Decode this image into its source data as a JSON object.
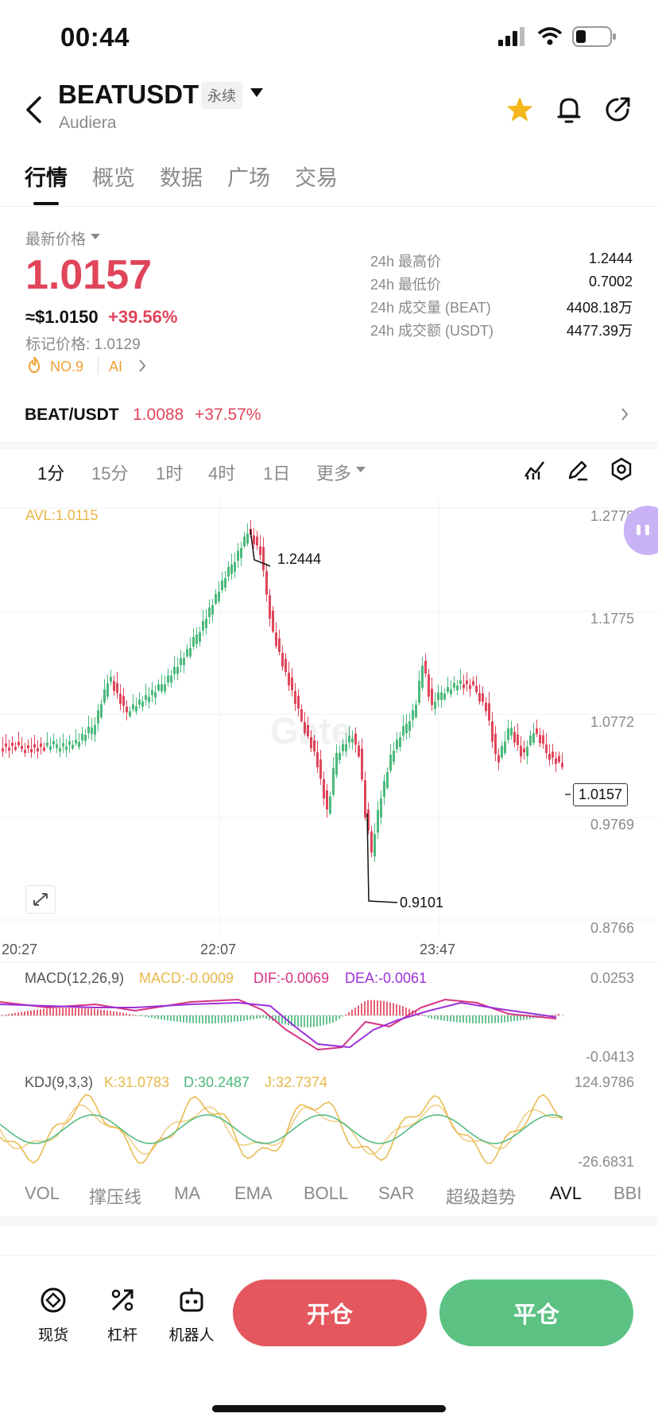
{
  "status": {
    "time": "00:44"
  },
  "header": {
    "symbol": "BEATUSDT",
    "badge": "永续",
    "subtitle": "Audiera"
  },
  "tabs": [
    "行情",
    "概览",
    "数据",
    "广场",
    "交易"
  ],
  "price": {
    "latest_label": "最新价格",
    "last": "1.0157",
    "usd": "≈$1.0150",
    "change": "+39.56%",
    "mark": "标记价格: 1.0129",
    "rank": "NO.9",
    "ai": "AI"
  },
  "stats": [
    {
      "label": "24h 最高价",
      "value": "1.2444"
    },
    {
      "label": "24h 最低价",
      "value": "0.7002"
    },
    {
      "label": "24h 成交量 (BEAT)",
      "value": "4408.18万"
    },
    {
      "label": "24h 成交额 (USDT)",
      "value": "4477.39万"
    }
  ],
  "spot": {
    "pair": "BEAT/USDT",
    "price": "1.0088",
    "change": "+37.57%"
  },
  "timeframes": [
    "1分",
    "15分",
    "1时",
    "4时",
    "1日",
    "更多"
  ],
  "chart": {
    "avl": "AVL:1.0115",
    "yticks": [
      "1.2778",
      "1.1775",
      "1.0772",
      "0.9769",
      "0.8766"
    ],
    "xticks": [
      "20:27",
      "22:07",
      "23:47"
    ],
    "high_label": "1.2444",
    "low_label": "0.9101",
    "current": "1.0157",
    "watermark": "Gate"
  },
  "macd": {
    "title": "MACD(12,26,9)",
    "macd": "MACD:-0.0009",
    "dif": "DIF:-0.0069",
    "dea": "DEA:-0.0061",
    "top": "0.0253",
    "bottom": "-0.0413"
  },
  "kdj": {
    "title": "KDJ(9,3,3)",
    "k": "K:31.0783",
    "d": "D:30.2487",
    "j": "J:32.7374",
    "top": "124.9786",
    "bottom": "-26.6831"
  },
  "indicators": [
    "VOL",
    "撑压线",
    "MA",
    "EMA",
    "BOLL",
    "SAR",
    "超级趋势",
    "AVL",
    "BBI"
  ],
  "bottom": {
    "spot": "现货",
    "leverage": "杠杆",
    "robot": "机器人",
    "open": "开仓",
    "close": "平仓"
  },
  "colors": {
    "up": "#4cb97c",
    "down": "#e0455a",
    "avl": "#e8b84a"
  }
}
